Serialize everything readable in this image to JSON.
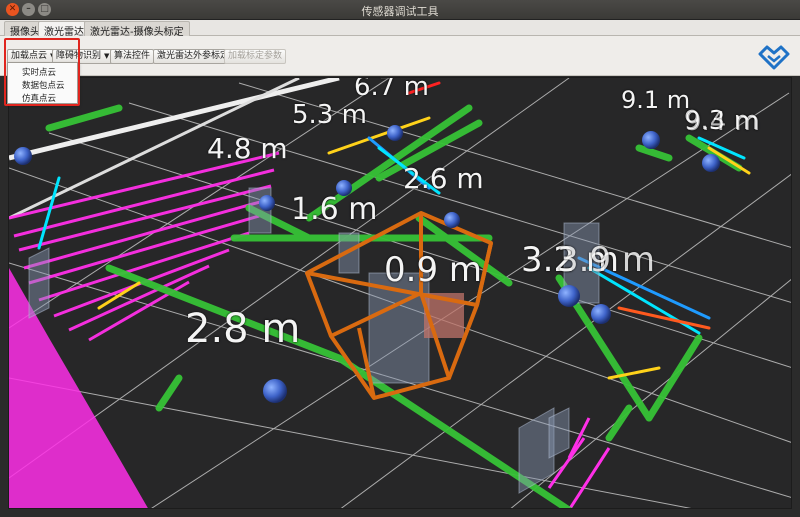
{
  "window": {
    "title": "传感器调试工具"
  },
  "tabs": [
    {
      "label": "摄像头"
    },
    {
      "label": "激光雷达"
    },
    {
      "label": "激光雷达-摄像头标定"
    }
  ],
  "toolbar": {
    "load_cloud": "加载点云",
    "obstacle_recognition": "障碍物识别",
    "algorithm_control": "算法控件",
    "lidar_extrinsic_calibration": "激光雷达外参标定",
    "load_calibration_params": "加载标定参数"
  },
  "load_cloud_menu": {
    "items": [
      "实时点云",
      "数据包点云",
      "仿真点云"
    ]
  },
  "viewport": {
    "distance_labels": [
      "6.7 m",
      "5.3 m",
      "4.8 m",
      "9.1 m",
      "9.3 m",
      "9.4 m",
      "2.6 m",
      "1.6 m",
      "0.9 m",
      "3.2 m",
      "3.9 m",
      "2.8 m"
    ],
    "colors": {
      "background": "#272728",
      "grid": "#d8d8d8",
      "ground_line": "#36c236",
      "far_cloud": "#ff2fe8",
      "bbox": "#d96a10"
    }
  }
}
